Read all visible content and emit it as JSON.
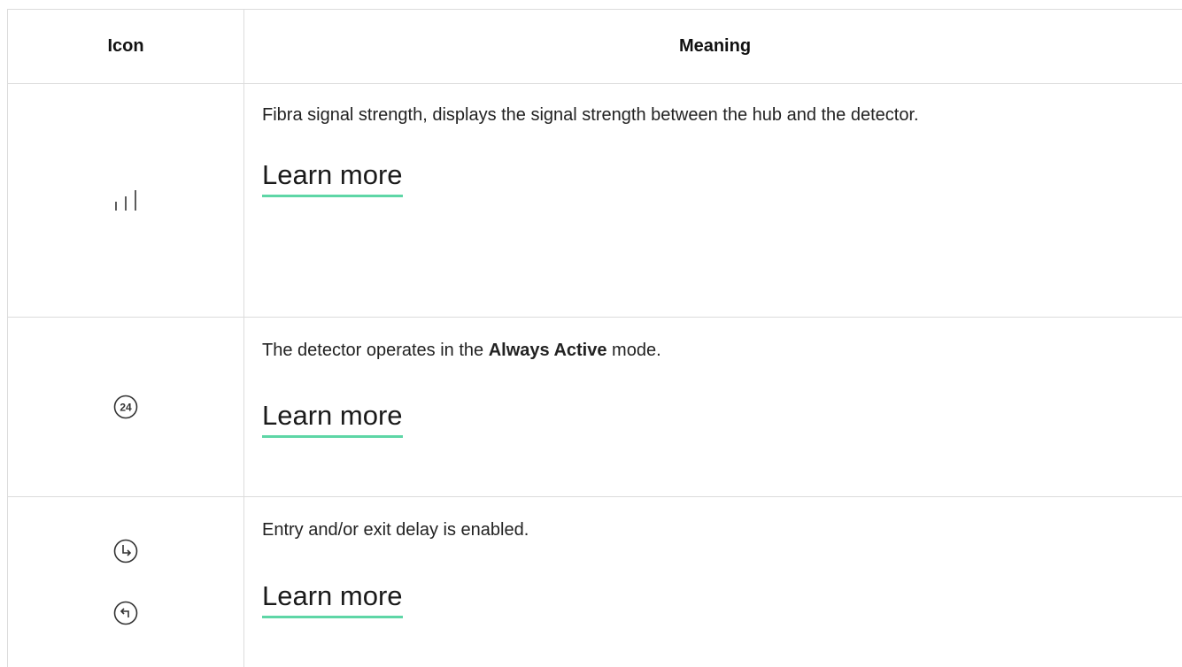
{
  "header": {
    "icon_col": "Icon",
    "meaning_col": "Meaning"
  },
  "rows": [
    {
      "icons": [
        "signal-strength-icon"
      ],
      "text": "Fibra signal strength, displays the signal strength between the hub and the detector.",
      "link": "Learn more"
    },
    {
      "icons": [
        "always-active-24-icon"
      ],
      "icon_text": "24",
      "text_before": "The detector operates in the ",
      "text_bold": "Always Active",
      "text_after": " mode.",
      "link": "Learn more"
    },
    {
      "icons": [
        "entry-delay-icon",
        "exit-delay-icon"
      ],
      "text": "Entry and/or exit delay is enabled.",
      "link": "Learn more"
    }
  ],
  "colors": {
    "link_underline": "#5ed6a6",
    "border": "#dcdcdc"
  }
}
